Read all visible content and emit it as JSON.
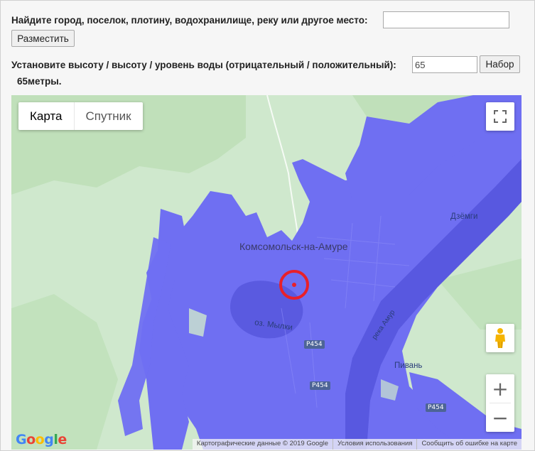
{
  "search": {
    "label": "Найдите город, поселок, плотину, водохранилище, реку или другое место:",
    "value": "",
    "button": "Разместить"
  },
  "height": {
    "label": "Установите высоту / высоту / уровень воды (отрицательный / положительный):",
    "value": "65",
    "button": "Набор",
    "result": "65метры."
  },
  "map": {
    "type_options": [
      "Карта",
      "Спутник"
    ],
    "active_type": "Карта",
    "labels": {
      "city": "Комсомольск-на-Амуре",
      "lake": "оз. Мылки",
      "village_1": "Дзёмги",
      "village_2": "Пивань",
      "river": "река Амур"
    },
    "road_shields": [
      "Р454",
      "Р454",
      "Р454"
    ],
    "zoom_in": "+",
    "zoom_out": "−",
    "logo": "Google",
    "attribution": {
      "data": "Картографические данные © 2019 Google",
      "terms": "Условия использования",
      "report": "Сообщить об ошибке на карте"
    },
    "colors": {
      "flood": "#6f6ff2",
      "land": "#cfe8cd",
      "forest": "#b8dcb0",
      "marker": "#e8202a"
    }
  },
  "icons": {
    "fullscreen": "fullscreen-icon",
    "pegman": "pegman-icon",
    "marker": "target-marker-icon"
  }
}
